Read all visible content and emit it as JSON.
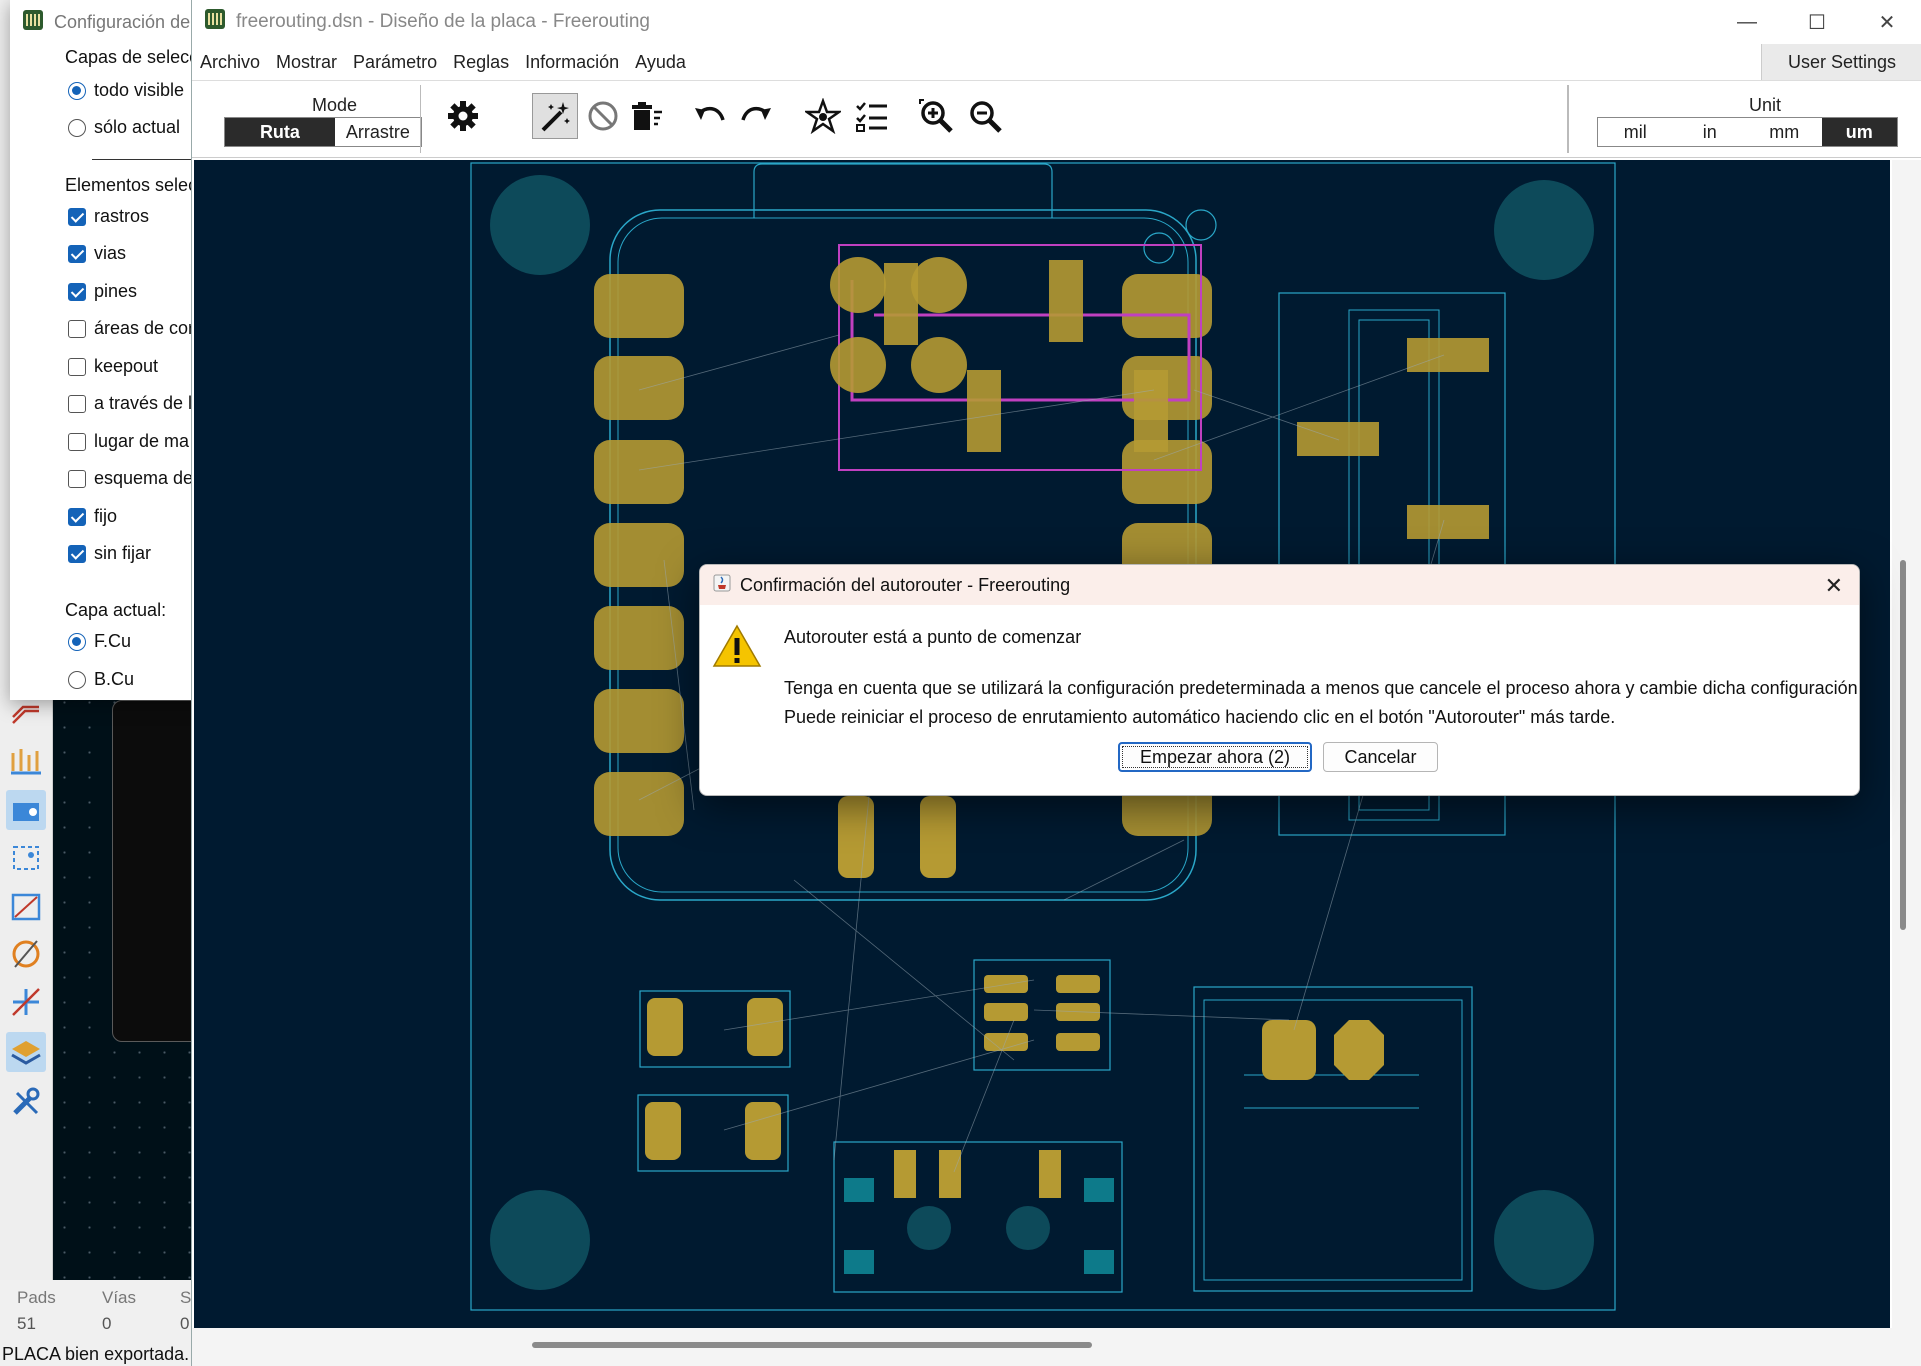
{
  "kicad": {
    "status": {
      "pads_label": "Pads",
      "pads_value": "51",
      "vias_label": "Vías",
      "vias_value": "0",
      "s_label": "S",
      "s_value": "0",
      "message": "PLACA bien exportada."
    }
  },
  "selection_window": {
    "title": "Configuración de",
    "layers_header": "Capas de selecc",
    "layer_options": [
      {
        "label": "todo visible",
        "selected": true
      },
      {
        "label": "sólo actual",
        "selected": false
      }
    ],
    "elements_header": "Elementos selec",
    "elements": [
      {
        "label": "rastros",
        "checked": true
      },
      {
        "label": "vias",
        "checked": true
      },
      {
        "label": "pines",
        "checked": true
      },
      {
        "label": "áreas de cor",
        "checked": false
      },
      {
        "label": "keepout",
        "checked": false
      },
      {
        "label": "a través de l",
        "checked": false
      },
      {
        "label": "lugar de ma",
        "checked": false
      },
      {
        "label": "esquema de",
        "checked": false
      },
      {
        "label": "fijo",
        "checked": true
      },
      {
        "label": "sin fijar",
        "checked": true
      }
    ],
    "current_layer_header": "Capa actual:",
    "current_layers": [
      {
        "label": "F.Cu",
        "selected": true
      },
      {
        "label": "B.Cu",
        "selected": false
      }
    ]
  },
  "main_window": {
    "title": "freerouting.dsn - Diseño de la placa - Freerouting",
    "menu": [
      "Archivo",
      "Mostrar",
      "Parámetro",
      "Reglas",
      "Información",
      "Ayuda"
    ],
    "user_settings": "User Settings",
    "mode_label": "Mode",
    "mode_options": [
      "Ruta",
      "Arrastre"
    ],
    "mode_selected": "Ruta",
    "unit_label": "Unit",
    "unit_options": [
      "mil",
      "in",
      "mm",
      "um"
    ],
    "unit_selected": "um",
    "toolbar_icons": [
      "settings-icon",
      "autoroute-wand-icon",
      "cancel-icon",
      "delete-trash-icon",
      "undo-icon",
      "redo-icon",
      "net-spider-icon",
      "checklist-icon",
      "zoom-in-icon",
      "zoom-out-icon"
    ]
  },
  "dialog": {
    "title": "Confirmación del autorouter - Freerouting",
    "heading": "Autorouter está a punto de comenzar",
    "line1": "Tenga en cuenta que se utilizará la configuración predeterminada a menos que cancele el proceso ahora y cambie dicha configuración.",
    "line2": "Puede reiniciar el proceso de enrutamiento automático haciendo clic en el botón \"Autorouter\" más tarde.",
    "start_button": "Empezar ahora (2)",
    "cancel_button": "Cancelar"
  },
  "colors": {
    "board_bg": "#001a30",
    "pad_copper": "#b59a33",
    "outline_cyan": "#2aa7c8",
    "keepout_magenta": "#c040c0",
    "mounting_hole": "#0d4a5a",
    "accent_blue": "#1463b8"
  }
}
